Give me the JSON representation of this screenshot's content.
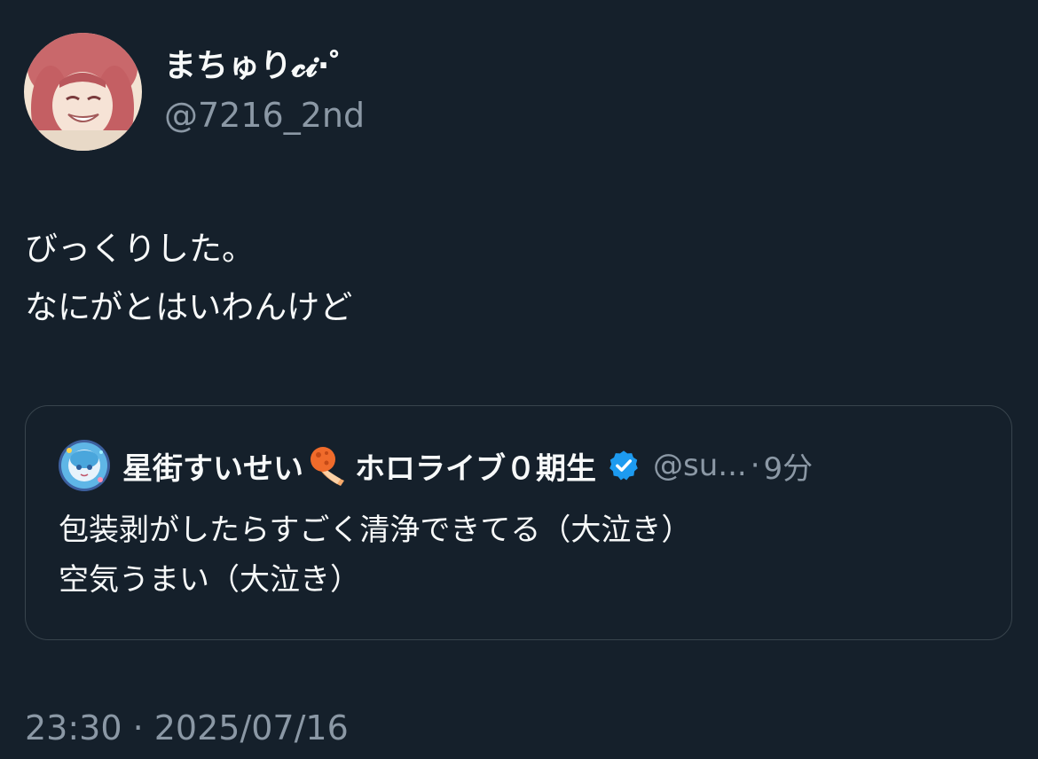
{
  "author": {
    "display_name": "まちゅり𝓬𝓲·゜",
    "handle": "@7216_2nd",
    "avatar_icon": "user-avatar-anime"
  },
  "tweet": {
    "lines": [
      "びっくりした。",
      "なにがとはいわんけど"
    ],
    "timestamp": "23:30 · 2025/07/16"
  },
  "quote": {
    "name_part1": "星街すいせい",
    "name_emoji": "comet-icon",
    "name_part2": "ホロライブ０期生",
    "verified": "verified-badge-icon",
    "handle": "@su...",
    "separator": "·",
    "time": "9分",
    "lines": [
      "包装剥がしたらすごく清浄できてる（大泣き）",
      "空気うまい（大泣き）"
    ]
  },
  "colors": {
    "background": "#15202b",
    "text_primary": "#f7f9f9",
    "text_secondary": "#8b98a5",
    "border": "#38444d",
    "verified": "#1d9bf0"
  }
}
